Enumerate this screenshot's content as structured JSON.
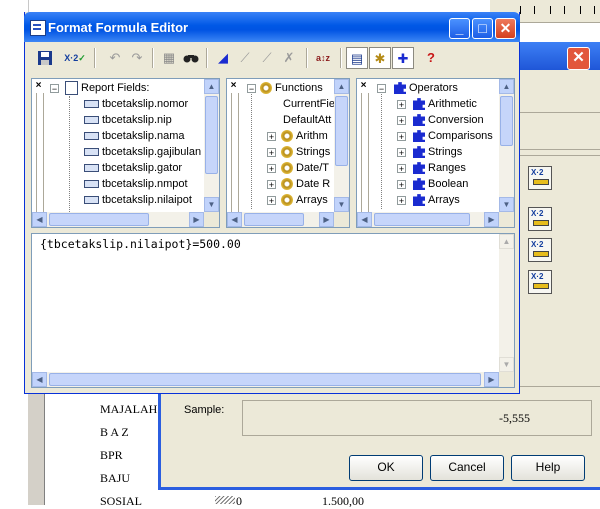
{
  "window": {
    "title": "Format Formula Editor"
  },
  "toolbar": {
    "items": [
      "save-icon",
      "check-formula-icon",
      "undo-icon",
      "redo-icon",
      "browse-field-icon",
      "find-icon",
      "bookmark-icon",
      "next-bookmark-icon",
      "previous-bookmark-icon",
      "clear-bookmarks-icon",
      "sort-icon",
      "toggle-fields-tree-icon",
      "toggle-functions-tree-icon",
      "toggle-operators-tree-icon",
      "help-icon"
    ]
  },
  "report_fields": {
    "root": "Report Fields:",
    "items": [
      "tbcetakslip.nomor",
      "tbcetakslip.nip",
      "tbcetakslip.nama",
      "tbcetakslip.gajibulan",
      "tbcetakslip.gator",
      "tbcetakslip.nmpot",
      "tbcetakslip.nilaipot"
    ]
  },
  "functions": {
    "root": "Functions",
    "leaf_items": [
      "CurrentFie",
      "DefaultAtt"
    ],
    "folder_items": [
      "Arithm",
      "Strings",
      "Date/T",
      "Date R",
      "Arrays"
    ]
  },
  "operators": {
    "root": "Operators",
    "items": [
      "Arithmetic",
      "Conversion",
      "Comparisons",
      "Strings",
      "Ranges",
      "Boolean",
      "Arrays"
    ]
  },
  "editor": {
    "formula": "{tbcetakslip.nilaipot}=500.00"
  },
  "background_dialog": {
    "sample_label": "Sample:",
    "sample_value": "-5,555",
    "ok_label": "OK",
    "cancel_label": "Cancel",
    "help_label": "Help"
  },
  "background_report": {
    "rows": [
      {
        "label": "MAJALAH",
        "amount": ""
      },
      {
        "label": "B A Z",
        "amount": ""
      },
      {
        "label": "BPR",
        "amount": ""
      },
      {
        "label": "BAJU",
        "amount": ""
      },
      {
        "label": "SOSIAL",
        "amount": "1.500,00",
        "zero": "0"
      }
    ]
  }
}
